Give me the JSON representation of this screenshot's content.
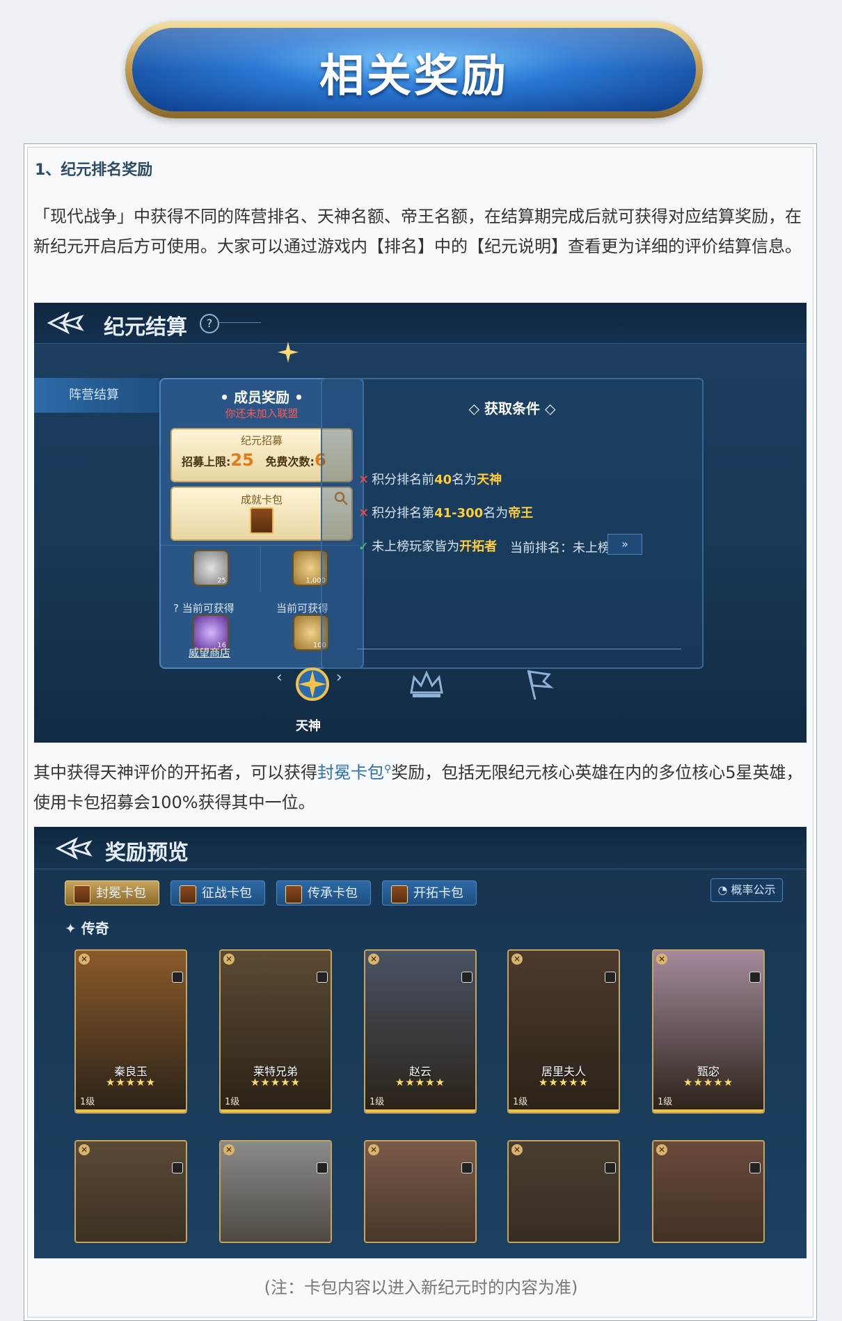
{
  "banner": {
    "title": "相关奖励"
  },
  "section": {
    "heading": "1、纪元排名奖励",
    "para1": "「现代战争」中获得不同的阵营排名、天神名额、帝王名额，在结算期完成后就可获得对应结算奖励，在新纪元开启后方可使用。大家可以通过游戏内【排名】中的【纪元说明】查看更为详细的评价结算信息。",
    "para2_before": "其中获得天神评价的开拓者，可以获得",
    "para2_link": "封冕卡包",
    "para2_after": "奖励，包括无限纪元核心英雄在内的多位核心5星英雄，使用卡包招募会100%获得其中一位。",
    "note": "(注：卡包内容以进入新纪元时的内容为准)"
  },
  "shot1": {
    "title": "纪元结算",
    "help": "?",
    "tab": "阵营结算",
    "member": {
      "title": "• 成员奖励 •",
      "warn": "你还未加入联盟",
      "card_a_title": "纪元招募",
      "limit_label": "招募上限:",
      "limit_value": "25",
      "free_label": "免费次数:",
      "free_value": "6",
      "card_b_title": "成就卡包",
      "token1_count": "25",
      "token2_count": "1,000",
      "current_label_1": "当前可获得",
      "current_label_2": "当前可获得",
      "token3_count": "16",
      "token4_count": "100",
      "shop": "威望商店"
    },
    "conditions": {
      "title": "获取条件",
      "row1_pre": "积分排名前",
      "row1_num": "40",
      "row1_mid": "名为",
      "row1_hl": "天神",
      "row2_pre": "积分排名第",
      "row2_num": "41-300",
      "row2_mid": "名为",
      "row2_hl": "帝王",
      "row3_pre": "未上榜玩家皆为",
      "row3_hl": "开拓者",
      "rank_label": "当前排名：未上榜",
      "rank_btn": "»"
    },
    "emblem_label": "天神"
  },
  "shot2": {
    "title": "奖励预览",
    "tabs": [
      {
        "label": "封冕卡包",
        "active": true
      },
      {
        "label": "征战卡包",
        "active": false
      },
      {
        "label": "传承卡包",
        "active": false
      },
      {
        "label": "开拓卡包",
        "active": false
      }
    ],
    "prob": "概率公示",
    "group": "✦ 传奇",
    "heroes": [
      {
        "name": "秦良玉",
        "stars": "★★★★★",
        "level": "1级",
        "color": "#8a5a2a"
      },
      {
        "name": "莱特兄弟",
        "stars": "★★★★★",
        "level": "1级",
        "color": "#5c4a32"
      },
      {
        "name": "赵云",
        "stars": "★★★★★",
        "level": "1级",
        "color": "#4a5364"
      },
      {
        "name": "居里夫人",
        "stars": "★★★★★",
        "level": "1级",
        "color": "#4d3a2c"
      },
      {
        "name": "甄宓",
        "stars": "★★★★★",
        "level": "1级",
        "color": "#a48a9c"
      }
    ],
    "row2_colors": [
      "#5a4a36",
      "#8a8a8a",
      "#7a5a48",
      "#4a3e32",
      "#6a4a3a"
    ]
  }
}
